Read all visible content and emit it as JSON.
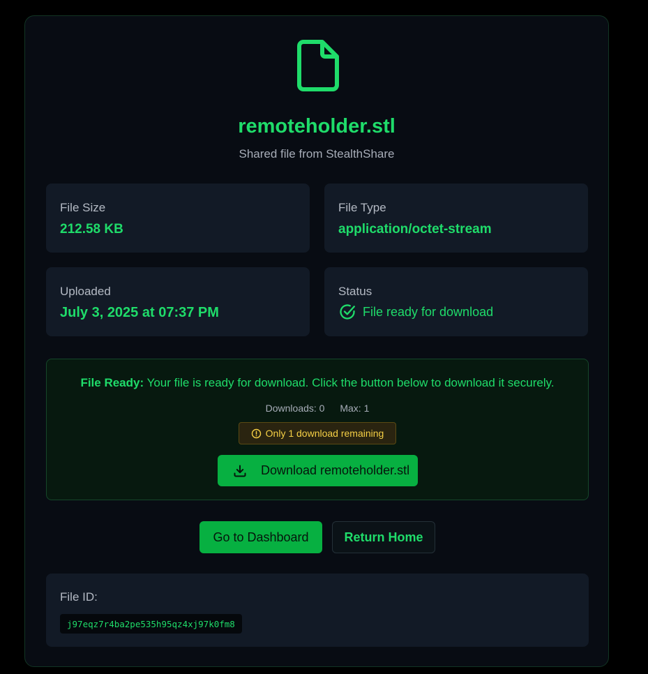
{
  "file": {
    "name": "remoteholder.stl",
    "subtitle": "Shared file from StealthShare",
    "icon": "file-icon"
  },
  "info": {
    "size_label": "File Size",
    "size_value": "212.58 KB",
    "type_label": "File Type",
    "type_value": "application/octet-stream",
    "uploaded_label": "Uploaded",
    "uploaded_value": "July 3, 2025 at 07:37 PM",
    "status_label": "Status",
    "status_value": "File ready for download",
    "status_icon": "check-circle-icon"
  },
  "ready_panel": {
    "heading": "File Ready:",
    "message": "Your file is ready for download. Click the button below to download it securely.",
    "downloads_text": "Downloads: 0",
    "max_text": "Max: 1",
    "remaining_text": "Only 1 download remaining",
    "remaining_icon": "alert-circle-icon",
    "download_label": "Download remoteholder.stl",
    "download_icon": "download-icon"
  },
  "actions": {
    "dashboard_label": "Go to Dashboard",
    "home_label": "Return Home"
  },
  "file_id": {
    "label": "File ID:",
    "value": "j97eqz7r4ba2pe535h95qz4xj97k0fm8"
  },
  "colors": {
    "accent": "#1fdc6a",
    "button": "#07b041",
    "warning": "#f5cf45",
    "card_bg": "#080c13",
    "tile_bg": "#121a26"
  }
}
